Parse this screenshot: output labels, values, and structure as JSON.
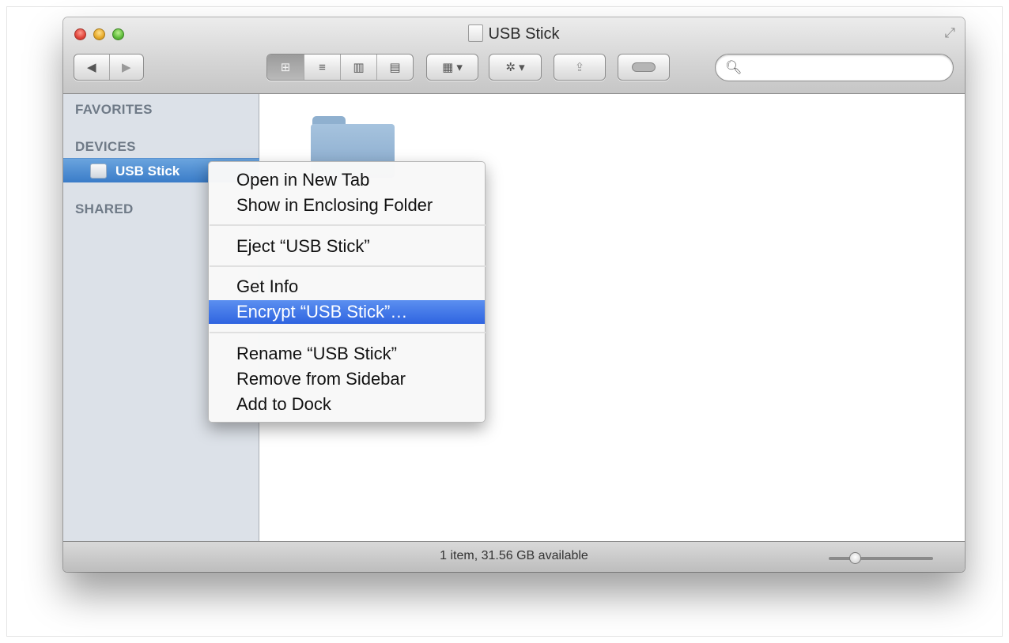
{
  "window": {
    "title": "USB Stick"
  },
  "toolbar": {
    "back_icon": "chevron-left-icon",
    "forward_icon": "chevron-right-icon",
    "view_buttons": [
      "icon-view",
      "list-view",
      "column-view",
      "cover-flow-view"
    ],
    "arrange_icon": "arrange-grid-icon",
    "action_icon": "gear-icon",
    "share_icon": "share-icon",
    "tags_icon": "tag-toggle-icon",
    "search": {
      "value": "",
      "placeholder": ""
    }
  },
  "sidebar": {
    "favorites_label": "FAVORITES",
    "devices_label": "DEVICES",
    "shared_label": "SHARED",
    "items": [
      {
        "label": "USB Stick",
        "icon": "usb-drive-icon",
        "selected": true
      }
    ]
  },
  "content": {
    "items": [
      {
        "icon": "folder-icon"
      }
    ]
  },
  "context_menu": {
    "items": [
      "Open in New Tab",
      "Show in Enclosing Folder",
      "Eject “USB Stick”",
      "Get Info",
      "Encrypt “USB Stick”…",
      "Rename “USB Stick”",
      "Remove from Sidebar",
      "Add to Dock"
    ],
    "highlighted_index": 4
  },
  "statusbar": {
    "text": "1 item, 31.56 GB available",
    "icon_size_slider_level": 0.25
  },
  "colors": {
    "selection_blue": "#3a7cc8",
    "menu_highlight": "#2f64e0",
    "sidebar_bg": "#dce1e8"
  }
}
